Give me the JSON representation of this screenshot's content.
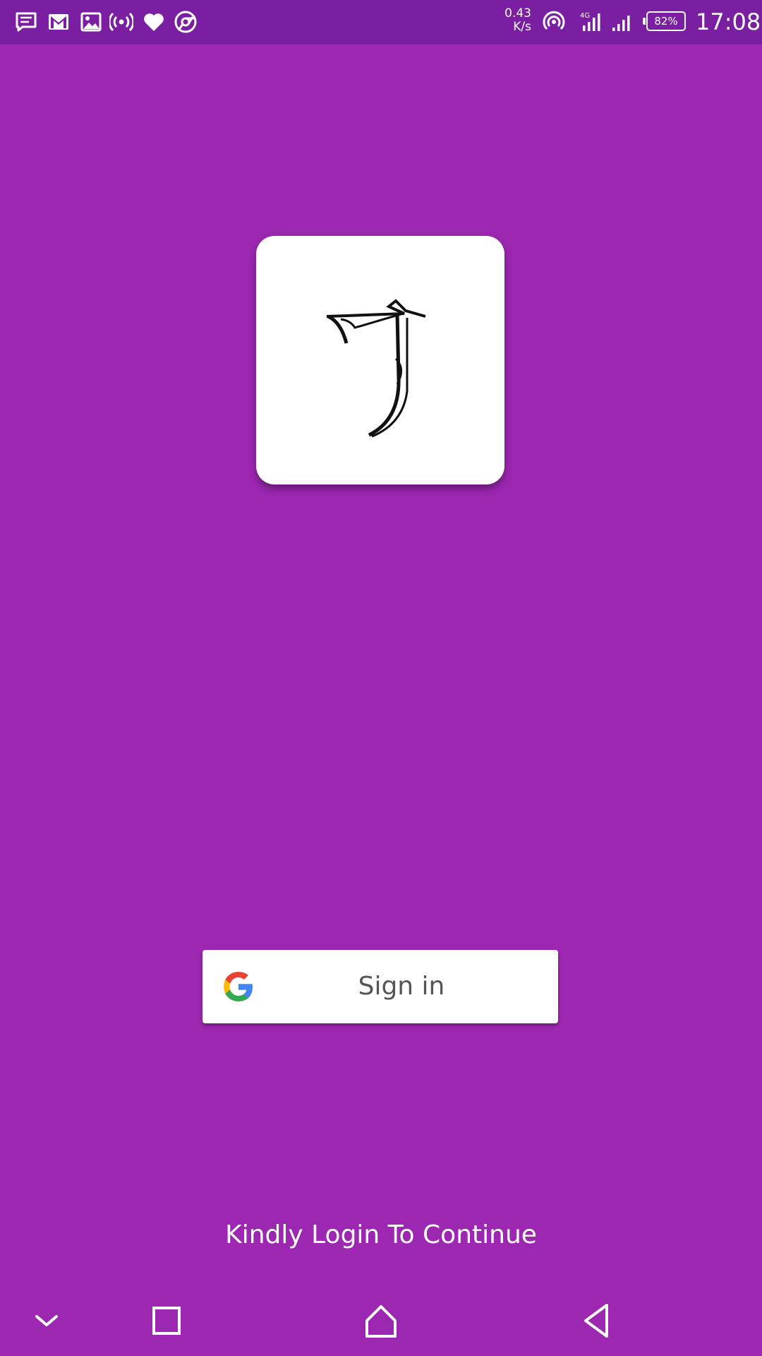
{
  "status_bar": {
    "left_icons": [
      "message-icon",
      "gmail-icon",
      "gallery-icon",
      "broadcast-icon",
      "heart-icon",
      "chrome-icon"
    ],
    "net_speed_value": "0.43",
    "net_speed_unit": "K/s",
    "right_icons": [
      "hotspot-icon",
      "signal-4g-icon",
      "signal-bars-icon"
    ],
    "battery": "82%",
    "time": "17:08",
    "background": "#7b1fa2"
  },
  "app": {
    "background": "#9c27b0",
    "logo": "stylized-j-logo"
  },
  "signin": {
    "label": "Sign in",
    "icon": "google-icon"
  },
  "footer": {
    "text": "Kindly Login To Continue"
  },
  "nav_bar": {
    "buttons": [
      "collapse-icon",
      "recents-icon",
      "home-icon",
      "back-icon"
    ]
  }
}
